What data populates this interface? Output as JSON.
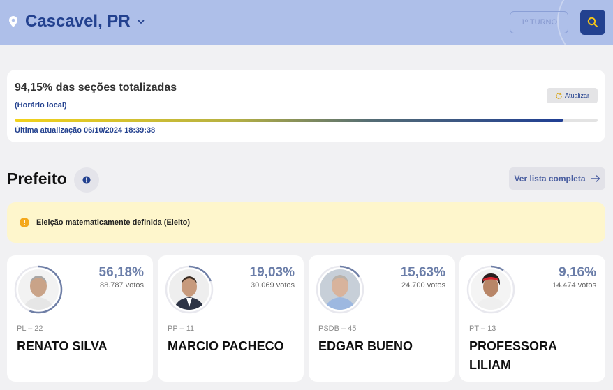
{
  "header": {
    "city": "Cascavel, PR",
    "turno_label": "1º TURNO",
    "icons": {
      "location": "map-pin-icon",
      "dropdown": "chevron-down-icon",
      "search": "search-icon"
    }
  },
  "status": {
    "title": "94,15% das seções totalizadas",
    "subtitle": "(Horário local)",
    "refresh_label": "Atualizar",
    "progress_percent": 94.15,
    "last_update": "Última atualização 06/10/2024 18:39:38"
  },
  "section": {
    "title": "Prefeito",
    "see_all_label": "Ver lista completa"
  },
  "alert": {
    "message": "Eleição matematicamente definida (Eleito)"
  },
  "colors": {
    "accent": "#23418f",
    "header_bg": "#aebfe9",
    "alert_bg": "#fef6cc",
    "percent_text": "#6a7da8"
  },
  "candidates": [
    {
      "party": "PL – 22",
      "name": "RENATO SILVA",
      "percent": "56,18%",
      "percent_value": 56.18,
      "votes": "88.787 votos"
    },
    {
      "party": "PP – 11",
      "name": "MARCIO PACHECO",
      "percent": "19,03%",
      "percent_value": 19.03,
      "votes": "30.069 votos"
    },
    {
      "party": "PSDB – 45",
      "name": "EDGAR BUENO",
      "percent": "15,63%",
      "percent_value": 15.63,
      "votes": "24.700 votos"
    },
    {
      "party": "PT – 13",
      "name": "PROFESSORA LILIAM",
      "percent": "9,16%",
      "percent_value": 9.16,
      "votes": "14.474 votos"
    }
  ]
}
